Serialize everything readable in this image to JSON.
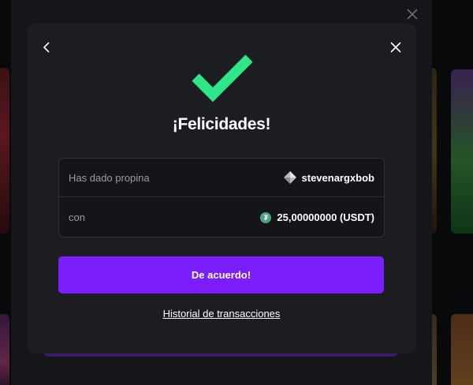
{
  "modal": {
    "title": "¡Felicidades!",
    "back_icon": "chevron-left-icon",
    "close_icon": "close-icon",
    "success_icon": "checkmark-icon",
    "success_color": "#2ee58a",
    "rows": [
      {
        "label": "Has dado propina",
        "value": "stevenargxbob",
        "icon": "diamond-user-icon"
      },
      {
        "label": "con",
        "value": "25,00000000 (USDT)",
        "icon": "tether-coin-icon"
      }
    ],
    "primary_button": "De acuerdo!",
    "history_link": "Historial de transacciones"
  },
  "colors": {
    "primary": "#7a1ffb",
    "modal_bg": "#1c1d21",
    "usdt": "#4fa083"
  }
}
